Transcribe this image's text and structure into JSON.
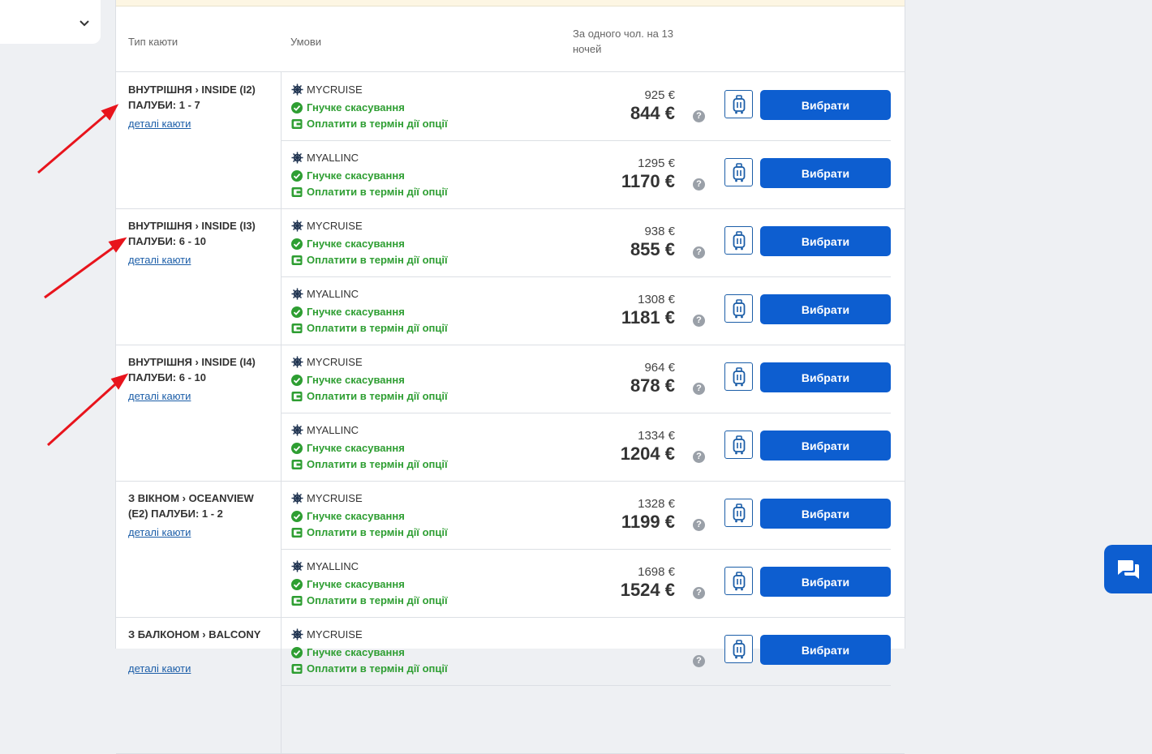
{
  "header": {
    "col_cabin": "Тип каюти",
    "col_terms": "Умови",
    "col_price_line1": "За одного чол. на 13",
    "col_price_line2": "ночей"
  },
  "labels": {
    "details": "деталі каюти",
    "flexible_cancel": "Гнучке скасування",
    "pay_in_term": "Оплатити в термін дії опції",
    "select": "Вибрати",
    "help": "?"
  },
  "cabins": [
    {
      "title": "Внутрішня › INSIDE (I2) ПАЛУБИ: 1 - 7",
      "offers": [
        {
          "rate": "MYCRUISE",
          "old": "925 €",
          "price": "844 €"
        },
        {
          "rate": "MYALLINC",
          "old": "1295 €",
          "price": "1170 €"
        }
      ]
    },
    {
      "title": "Внутрішня › INSIDE (I3) ПАЛУБИ: 6 - 10",
      "offers": [
        {
          "rate": "MYCRUISE",
          "old": "938 €",
          "price": "855 €"
        },
        {
          "rate": "MYALLINC",
          "old": "1308 €",
          "price": "1181 €"
        }
      ]
    },
    {
      "title": "Внутрішня › INSIDE (I4) ПАЛУБИ: 6 - 10",
      "offers": [
        {
          "rate": "MYCRUISE",
          "old": "964 €",
          "price": "878 €"
        },
        {
          "rate": "MYALLINC",
          "old": "1334 €",
          "price": "1204 €"
        }
      ]
    },
    {
      "title": "З вікном › OCEANVIEW (E2) ПАЛУБИ: 1 - 2",
      "offers": [
        {
          "rate": "MYCRUISE",
          "old": "1328 €",
          "price": "1199 €"
        },
        {
          "rate": "MYALLINC",
          "old": "1698 €",
          "price": "1524 €"
        }
      ]
    },
    {
      "title": "З балконом › BALCONY",
      "offers": [
        {
          "rate": "MYCRUISE",
          "old": "",
          "price": ""
        }
      ]
    }
  ],
  "icons": {
    "rate": "ship-wheel-icon",
    "cancel": "check-circle-icon",
    "payment": "wallet-icon",
    "luggage": "suitcase-icon",
    "chat": "chat-icon",
    "dropdown": "chevron-down-icon"
  },
  "colors": {
    "accent": "#0d5ed0",
    "success": "#2e9e32",
    "link": "#1c5ea8",
    "annotation": "#e8141c"
  }
}
